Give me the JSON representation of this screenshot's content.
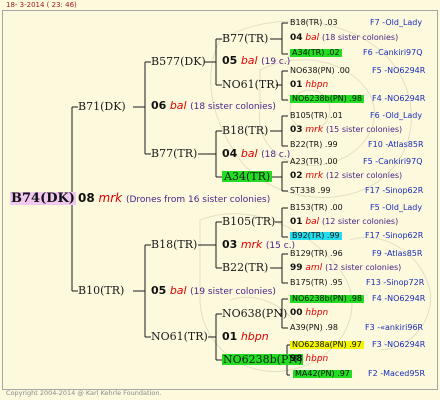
{
  "header": {
    "date": "18- 3-2014 ( 23: 46)"
  },
  "footer": {
    "copyright": "Copyright 2004-2014 @ Karl Kehrle Foundation."
  },
  "colors": {
    "background": "#fcf9dd",
    "highlight_green": "#22dd22",
    "highlight_cyan": "#22ddee",
    "highlight_yellow": "#f4f400",
    "root_highlight": "#f0c8f0",
    "breeder_red": "#e00000",
    "sister_purple": "#4a1f86",
    "pedigree_blue": "#1a2bbd"
  },
  "root": {
    "name": "B74(DK)",
    "year": "08",
    "breeder": "mrk",
    "note": "(Drones from 16 sister colonies)"
  },
  "gen1": [
    {
      "name": "B71(DK)",
      "year": "06",
      "breeder": "bal",
      "note": "(18 sister colonies)"
    },
    {
      "name": "B10(TR)",
      "year": "05",
      "breeder": "bal",
      "note": "(19 sister colonies)"
    }
  ],
  "gen2": [
    {
      "name": "B577(DK)",
      "year": "05",
      "breeder": "bal",
      "note": "(19 c.)"
    },
    {
      "name": "B77(TR)",
      "year": "04",
      "breeder": "bal",
      "note": "(18 c.)"
    },
    {
      "name": "B18(TR)",
      "year": "03",
      "breeder": "mrk",
      "note": "(15 c.)"
    },
    {
      "name": "NO61(TR)",
      "year": "01",
      "breeder": "hbpn",
      "note": ""
    }
  ],
  "gen3": [
    {
      "name": "B77(TR)"
    },
    {
      "name": "NO61(TR)"
    },
    {
      "name": "B18(TR)"
    },
    {
      "name": "A34(TR)"
    },
    {
      "name": "B105(TR)"
    },
    {
      "name": "B22(TR)"
    },
    {
      "name": "NO638(PN)"
    },
    {
      "name": "NO6238b(PN)"
    }
  ],
  "gen4": [
    {
      "name": "B18(TR) .03",
      "ped": "F7 -Old_Lady"
    },
    {
      "year": "04",
      "breeder": "bal",
      "note": "(18 sister colonies)"
    },
    {
      "name": "A34(TR) .02",
      "ped": "F6 -Cankiri97Q"
    },
    {
      "name": "NO638(PN) .00",
      "ped": "F5 -NO6294R"
    },
    {
      "year": "01",
      "breeder": "hbpn",
      "note": ""
    },
    {
      "name": "NO6238b(PN) .98",
      "ped": "F4 -NO6294R"
    },
    {
      "name": "B105(TR) .01",
      "ped": "F6 -Old_Lady"
    },
    {
      "year": "03",
      "breeder": "mrk",
      "note": "(15 sister colonies)"
    },
    {
      "name": "B22(TR) .99",
      "ped": "F10 -Atlas85R"
    },
    {
      "name": "A23(TR) .00",
      "ped": "F5 -Cankiri97Q"
    },
    {
      "year": "02",
      "breeder": "mrk",
      "note": "(12 sister colonies)"
    },
    {
      "name": "ST338 .99",
      "ped": "F17 -Sinop62R"
    },
    {
      "name": "B153(TR) .00",
      "ped": "F5 -Old_Lady"
    },
    {
      "year": "01",
      "breeder": "bal",
      "note": "(12 sister colonies)"
    },
    {
      "name": "B92(TR) .99",
      "ped": "F17 -Sinop62R"
    },
    {
      "name": "B129(TR) .96",
      "ped": "F9 -Atlas85R"
    },
    {
      "year": "99",
      "breeder": "aml",
      "note": "(12 sister colonies)"
    },
    {
      "name": "B175(TR) .95",
      "ped": "F13 -Sinop72R"
    },
    {
      "name": "NO6238b(PN) .98",
      "ped": "F4 -NO6294R"
    },
    {
      "year": "00",
      "breeder": "hbpn",
      "note": ""
    },
    {
      "name": "A39(PN) .98",
      "ped": "F3 -«ankiri96R"
    },
    {
      "name": "NO6238a(PN) .97",
      "ped": "F3 -NO6294R"
    },
    {
      "year": "98",
      "breeder": "hbpn",
      "note": ""
    },
    {
      "name": "MA42(PN) .97",
      "ped": "F2 -Maced95R"
    }
  ]
}
